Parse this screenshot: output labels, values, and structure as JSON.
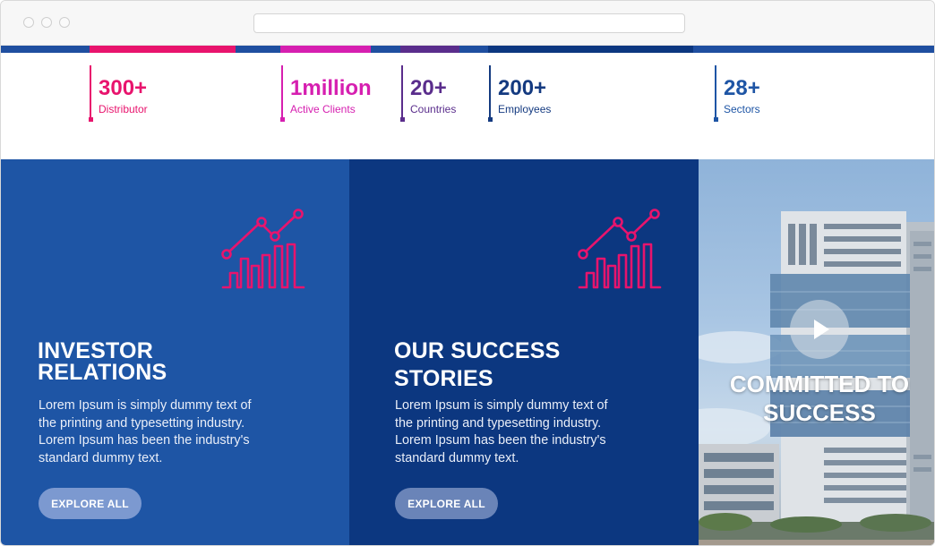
{
  "colors": {
    "pink": "#e8146d",
    "magenta": "#d61fb0",
    "purple": "#5a2d8c",
    "navy": "#143a80",
    "blue": "#1e55a5",
    "dark_blue": "#0c3780",
    "chart_icon": "#e8146d"
  },
  "stats": [
    {
      "value": "300+",
      "label": "Distributor",
      "color": "#e8146d"
    },
    {
      "value": "1million",
      "label": "Active Clients",
      "color": "#d61fb0"
    },
    {
      "value": "20+",
      "label": "Countries",
      "color": "#5a2d8c"
    },
    {
      "value": "200+",
      "label": "Employees",
      "color": "#143a80"
    },
    {
      "value": "28+",
      "label": "Sectors",
      "color": "#1e55a5"
    }
  ],
  "investor": {
    "icon": "line-bar-chart-icon",
    "title_line1": "INVESTOR",
    "title_line2": "RELATIONS",
    "description": "Lorem Ipsum is simply dummy text of the printing and typesetting industry. Lorem Ipsum has been the industry's standard dummy text.",
    "button_label": "EXPLORE ALL"
  },
  "success": {
    "icon": "line-bar-chart-icon",
    "title_line1": "OUR SUCCESS",
    "title_line2": "STORIES",
    "description": "Lorem Ipsum is simply dummy text of the printing and typesetting industry. Lorem Ipsum has been the industry's standard dummy text.",
    "button_label": "EXPLORE ALL"
  },
  "hero": {
    "icon": "play-icon",
    "title_line1": "COMMITTED TO",
    "title_line2": "SUCCESS"
  }
}
